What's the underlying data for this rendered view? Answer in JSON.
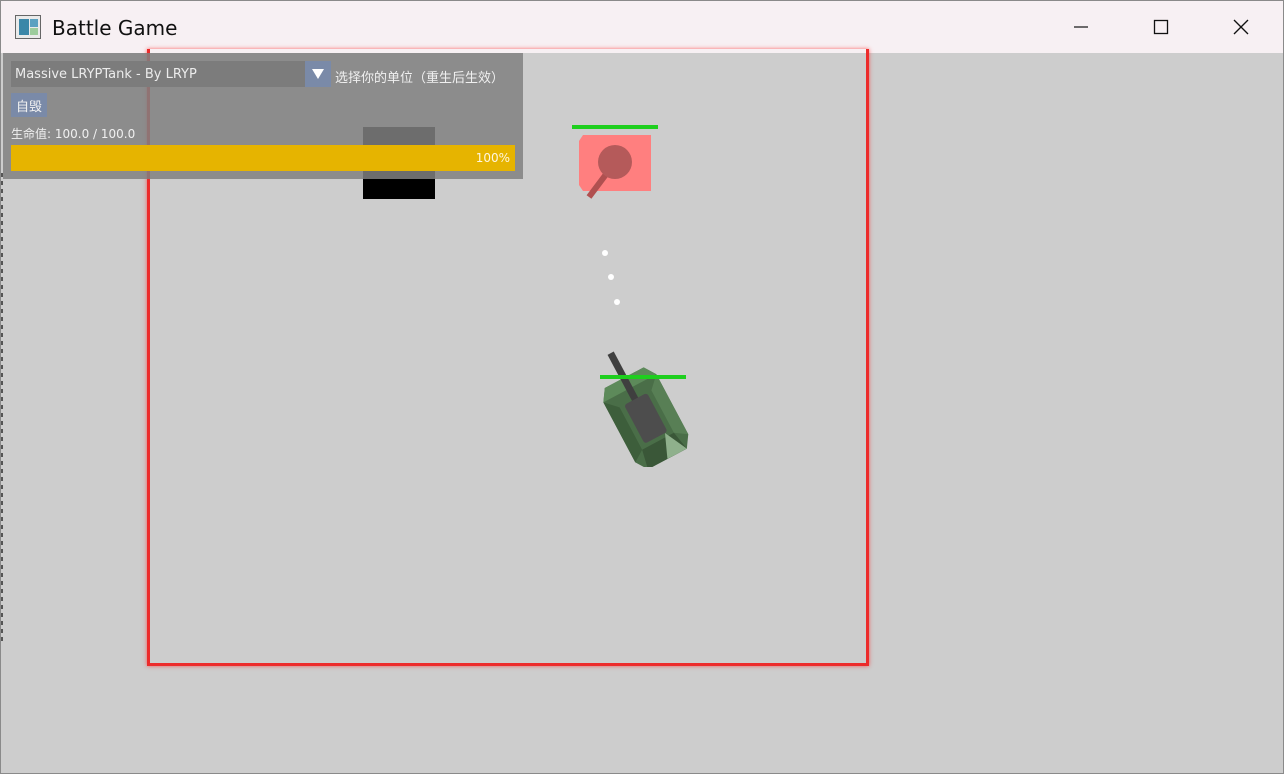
{
  "window": {
    "title": "Battle Game",
    "icon": "app-icon",
    "controls": [
      "minimize-icon",
      "maximize-icon",
      "close-icon"
    ]
  },
  "hud": {
    "unit_select": {
      "value": "Massive LRYPTank - By LRYP",
      "hint": "选择你的单位（重生后生效）"
    },
    "self_destruct_label": "自毁",
    "health": {
      "label": "生命值: 100.0 / 100.0",
      "current": 100.0,
      "max": 100.0,
      "percent_label": "100%",
      "fill_fraction": 1.0,
      "fill_color": "#e6b400"
    }
  },
  "arena": {
    "border_color": "#ec2b2b",
    "background_color": "#cdcdcd"
  },
  "units": {
    "enemy": {
      "health_fraction": 1.0,
      "color": "#ff7f7f",
      "health_color": "#1ecf1e"
    },
    "player": {
      "health_fraction": 1.0,
      "color": "#4a6e48",
      "health_color": "#1ecf1e"
    }
  }
}
